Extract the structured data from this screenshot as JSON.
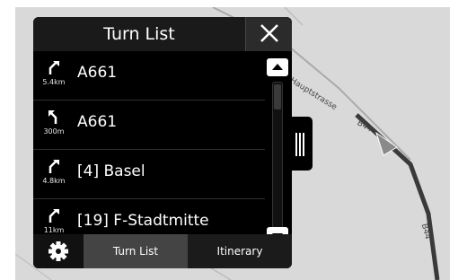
{
  "panel": {
    "title": "Turn List",
    "close_icon": "close-icon"
  },
  "turns": [
    {
      "road": "A661",
      "distance": "5.4km",
      "icon": "turn-slight-right-icon"
    },
    {
      "road": "A661",
      "distance": "300m",
      "icon": "turn-slight-left-icon"
    },
    {
      "road": "[4] Basel",
      "distance": "4.8km",
      "icon": "turn-slight-right-icon"
    },
    {
      "road": "[19] F-Stadtmitte",
      "distance": "11km",
      "icon": "turn-slight-right-icon"
    }
  ],
  "tabs": {
    "settings_icon": "gear-icon",
    "turn_list": "Turn List",
    "itinerary": "Itinerary",
    "active": "turn_list"
  },
  "map": {
    "road_labels": [
      "Hauptstrasse",
      "B44",
      "B44"
    ]
  },
  "colors": {
    "panel_bg": "#000000",
    "active_tab": "#444444",
    "map_bg": "#d9d9d9",
    "route": "#3a3a3a"
  }
}
